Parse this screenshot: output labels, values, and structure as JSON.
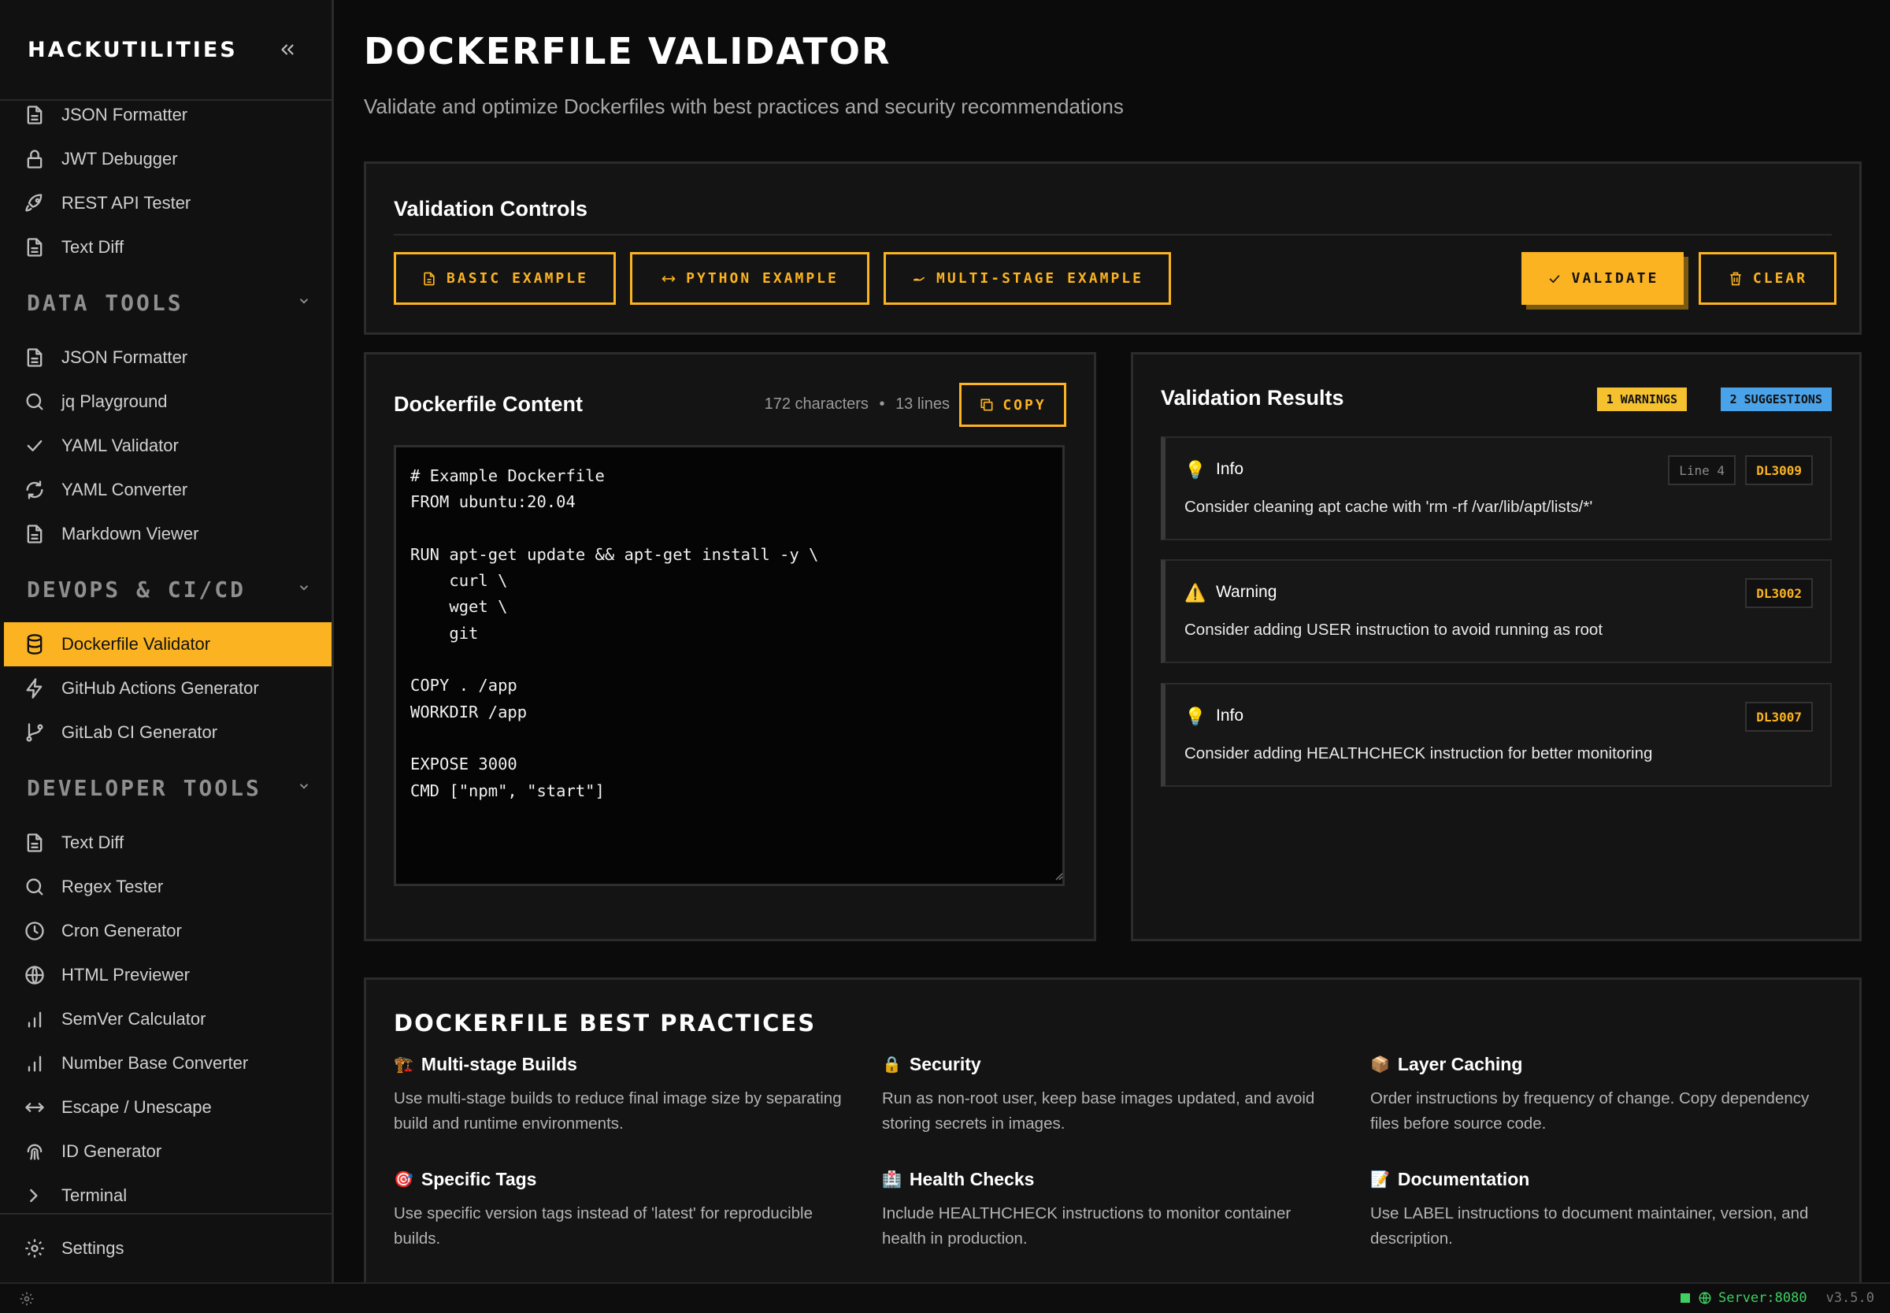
{
  "app": {
    "brand": "HACKUTILITIES"
  },
  "sidebar": {
    "top_items": [
      {
        "label": "JSON Formatter",
        "icon": "file-icon"
      },
      {
        "label": "JWT Debugger",
        "icon": "lock-icon"
      },
      {
        "label": "REST API Tester",
        "icon": "rocket-icon"
      },
      {
        "label": "Text Diff",
        "icon": "file-icon"
      }
    ],
    "sections": [
      {
        "title": "DATA TOOLS",
        "items": [
          {
            "label": "JSON Formatter",
            "icon": "file-icon"
          },
          {
            "label": "jq Playground",
            "icon": "search-icon"
          },
          {
            "label": "YAML Validator",
            "icon": "check-icon"
          },
          {
            "label": "YAML Converter",
            "icon": "refresh-icon"
          },
          {
            "label": "Markdown Viewer",
            "icon": "file-icon"
          }
        ]
      },
      {
        "title": "DEVOPS & CI/CD",
        "items": [
          {
            "label": "Dockerfile Validator",
            "icon": "database-icon",
            "active": true
          },
          {
            "label": "GitHub Actions Generator",
            "icon": "lightning-icon"
          },
          {
            "label": "GitLab CI Generator",
            "icon": "git-branch-icon"
          }
        ]
      },
      {
        "title": "DEVELOPER TOOLS",
        "items": [
          {
            "label": "Text Diff",
            "icon": "file-icon"
          },
          {
            "label": "Regex Tester",
            "icon": "search-icon"
          },
          {
            "label": "Cron Generator",
            "icon": "clock-icon"
          },
          {
            "label": "HTML Previewer",
            "icon": "globe-icon"
          },
          {
            "label": "SemVer Calculator",
            "icon": "bar-chart-icon"
          },
          {
            "label": "Number Base Converter",
            "icon": "bar-chart-icon"
          },
          {
            "label": "Escape / Unescape",
            "icon": "arrows-horizontal-icon"
          },
          {
            "label": "ID Generator",
            "icon": "fingerprint-icon"
          },
          {
            "label": "Terminal",
            "icon": "chevron-right-icon"
          }
        ]
      }
    ],
    "footer": {
      "label": "Settings"
    }
  },
  "page": {
    "title": "DOCKERFILE VALIDATOR",
    "subtitle": "Validate and optimize Dockerfiles with best practices and security recommendations"
  },
  "controls": {
    "title": "Validation Controls",
    "basic": "BASIC EXAMPLE",
    "python": "PYTHON EXAMPLE",
    "multistage": "MULTI-STAGE EXAMPLE",
    "validate": "VALIDATE",
    "clear": "CLEAR"
  },
  "editor": {
    "title": "Dockerfile Content",
    "chars": "172 characters",
    "sep": "•",
    "lines": "13 lines",
    "copy": "COPY",
    "content": "# Example Dockerfile\nFROM ubuntu:20.04\n\nRUN apt-get update && apt-get install -y \\\n    curl \\\n    wget \\\n    git\n\nCOPY . /app\nWORKDIR /app\n\nEXPOSE 3000\nCMD [\"npm\", \"start\"]"
  },
  "results": {
    "title": "Validation Results",
    "warnings_badge": "1 WARNINGS",
    "suggestions_badge": "2 SUGGESTIONS",
    "items": [
      {
        "type": "Info",
        "icon": "💡",
        "line": "Line 4",
        "code": "DL3009",
        "message": "Consider cleaning apt cache with 'rm -rf /var/lib/apt/lists/*'"
      },
      {
        "type": "Warning",
        "icon": "⚠️",
        "code": "DL3002",
        "message": "Consider adding USER instruction to avoid running as root"
      },
      {
        "type": "Info",
        "icon": "💡",
        "code": "DL3007",
        "message": "Consider adding HEALTHCHECK instruction for better monitoring"
      }
    ]
  },
  "practices": {
    "title": "DOCKERFILE BEST PRACTICES",
    "items": [
      {
        "emoji": "🏗️",
        "title": "Multi-stage Builds",
        "desc": "Use multi-stage builds to reduce final image size by separating build and runtime environments."
      },
      {
        "emoji": "🔒",
        "title": "Security",
        "desc": "Run as non-root user, keep base images updated, and avoid storing secrets in images."
      },
      {
        "emoji": "📦",
        "title": "Layer Caching",
        "desc": "Order instructions by frequency of change. Copy dependency files before source code."
      },
      {
        "emoji": "🎯",
        "title": "Specific Tags",
        "desc": "Use specific version tags instead of 'latest' for reproducible builds."
      },
      {
        "emoji": "🏥",
        "title": "Health Checks",
        "desc": "Include HEALTHCHECK instructions to monitor container health in production."
      },
      {
        "emoji": "📝",
        "title": "Documentation",
        "desc": "Use LABEL instructions to document maintainer, version, and description."
      }
    ]
  },
  "status": {
    "server": "Server:8080",
    "version": "v3.5.0"
  },
  "colors": {
    "accent": "#fbb321",
    "warning": "#f5c12e",
    "suggestion": "#4aa3e8",
    "online": "#3fcf63"
  }
}
